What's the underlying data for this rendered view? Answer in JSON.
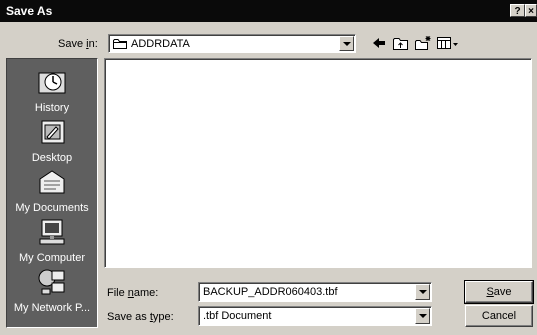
{
  "window": {
    "title": "Save As",
    "help_button": "?",
    "close_button": "×"
  },
  "save_in": {
    "label_pre": "Save ",
    "label_key": "i",
    "label_post": "n:",
    "value": "ADDRDATA"
  },
  "toolbar": {
    "icons": [
      "back-arrow-icon",
      "up-folder-icon",
      "new-folder-icon",
      "view-menu-icon"
    ]
  },
  "places": [
    {
      "label": "History",
      "icon": "history-icon"
    },
    {
      "label": "Desktop",
      "icon": "desktop-icon"
    },
    {
      "label": "My Documents",
      "icon": "my-documents-icon"
    },
    {
      "label": "My Computer",
      "icon": "my-computer-icon"
    },
    {
      "label": "My Network P...",
      "icon": "my-network-places-icon"
    }
  ],
  "file_name": {
    "label_pre": "File ",
    "label_key": "n",
    "label_post": "ame:",
    "value": "BACKUP_ADDR060403.tbf"
  },
  "save_as_type": {
    "label_pre": "Save as ",
    "label_key": "t",
    "label_post": "ype:",
    "value": ".tbf Document"
  },
  "buttons": {
    "save_key": "S",
    "save_rest": "ave",
    "cancel": "Cancel"
  }
}
